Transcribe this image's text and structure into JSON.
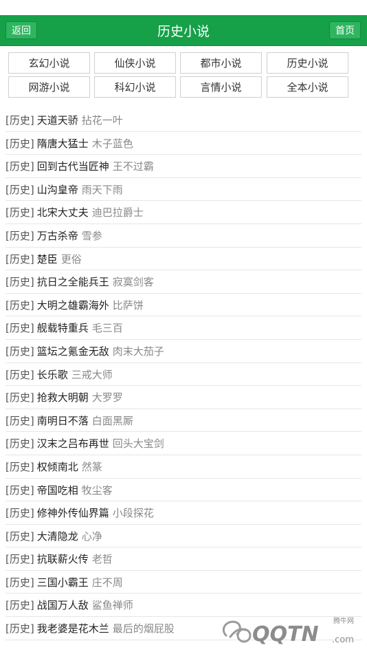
{
  "header": {
    "back_label": "返回",
    "title": "历史小说",
    "home_label": "首页"
  },
  "categories": [
    "玄幻小说",
    "仙侠小说",
    "都市小说",
    "历史小说",
    "网游小说",
    "科幻小说",
    "言情小说",
    "全本小说"
  ],
  "books": [
    {
      "tag": "[历史]",
      "title": "天道天骄",
      "author": "拈花一叶"
    },
    {
      "tag": "[历史]",
      "title": "隋唐大猛士",
      "author": "木子蓝色"
    },
    {
      "tag": "[历史]",
      "title": "回到古代当匠神",
      "author": "王不过霸"
    },
    {
      "tag": "[历史]",
      "title": "山沟皇帝",
      "author": "雨天下雨"
    },
    {
      "tag": "[历史]",
      "title": "北宋大丈夫",
      "author": "迪巴拉爵士"
    },
    {
      "tag": "[历史]",
      "title": "万古杀帝",
      "author": "雪参"
    },
    {
      "tag": "[历史]",
      "title": "楚臣",
      "author": "更俗"
    },
    {
      "tag": "[历史]",
      "title": "抗日之全能兵王",
      "author": "寂寞剑客"
    },
    {
      "tag": "[历史]",
      "title": "大明之雄霸海外",
      "author": "比萨饼"
    },
    {
      "tag": "[历史]",
      "title": "舰载特重兵",
      "author": "毛三百"
    },
    {
      "tag": "[历史]",
      "title": "篮坛之氪金无敌",
      "author": "肉末大茄子"
    },
    {
      "tag": "[历史]",
      "title": "长乐歌",
      "author": "三戒大师"
    },
    {
      "tag": "[历史]",
      "title": "抢救大明朝",
      "author": "大罗罗"
    },
    {
      "tag": "[历史]",
      "title": "南明日不落",
      "author": "白面黑厮"
    },
    {
      "tag": "[历史]",
      "title": "汉末之吕布再世",
      "author": "回头大宝剑"
    },
    {
      "tag": "[历史]",
      "title": "权倾南北",
      "author": "然篆"
    },
    {
      "tag": "[历史]",
      "title": "帝国吃相",
      "author": "牧尘客"
    },
    {
      "tag": "[历史]",
      "title": "修神外传仙界篇",
      "author": "小段探花"
    },
    {
      "tag": "[历史]",
      "title": "大清隐龙",
      "author": "心净"
    },
    {
      "tag": "[历史]",
      "title": "抗联薪火传",
      "author": "老哲"
    },
    {
      "tag": "[历史]",
      "title": "三国小霸王",
      "author": "庄不周"
    },
    {
      "tag": "[历史]",
      "title": "战国万人敌",
      "author": "鲨鱼禅师"
    },
    {
      "tag": "[历史]",
      "title": "我老婆是花木兰",
      "author": "最后的烟屁股"
    }
  ],
  "watermark": {
    "top_text": "腾牛网",
    "main_text": "QQTN",
    "suffix": ".com"
  }
}
